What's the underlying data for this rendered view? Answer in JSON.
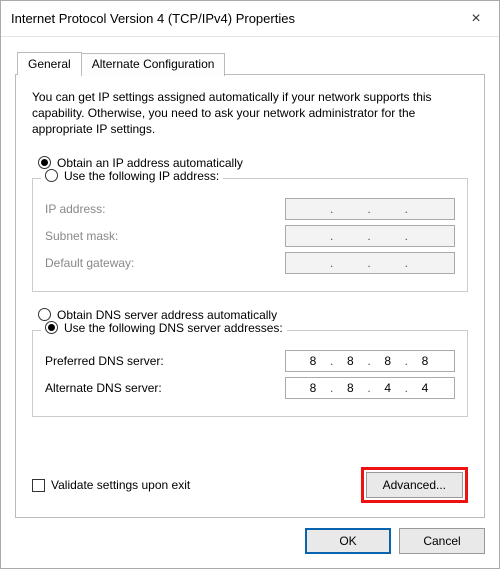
{
  "window": {
    "title": "Internet Protocol Version 4 (TCP/IPv4) Properties"
  },
  "tabs": {
    "general": "General",
    "alternate": "Alternate Configuration"
  },
  "intro": "You can get IP settings assigned automatically if your network supports this capability. Otherwise, you need to ask your network administrator for the appropriate IP settings.",
  "ip": {
    "auto_label": "Obtain an IP address automatically",
    "manual_label": "Use the following IP address:",
    "selected": "auto",
    "fields": {
      "address_label": "IP address:",
      "mask_label": "Subnet mask:",
      "gateway_label": "Default gateway:",
      "address": "",
      "mask": "",
      "gateway": ""
    }
  },
  "dns": {
    "auto_label": "Obtain DNS server address automatically",
    "manual_label": "Use the following DNS server addresses:",
    "selected": "manual",
    "fields": {
      "preferred_label": "Preferred DNS server:",
      "alternate_label": "Alternate DNS server:",
      "preferred": [
        "8",
        "8",
        "8",
        "8"
      ],
      "alternate": [
        "8",
        "8",
        "4",
        "4"
      ]
    }
  },
  "validate_label": "Validate settings upon exit",
  "validate_checked": false,
  "buttons": {
    "advanced": "Advanced...",
    "ok": "OK",
    "cancel": "Cancel"
  }
}
